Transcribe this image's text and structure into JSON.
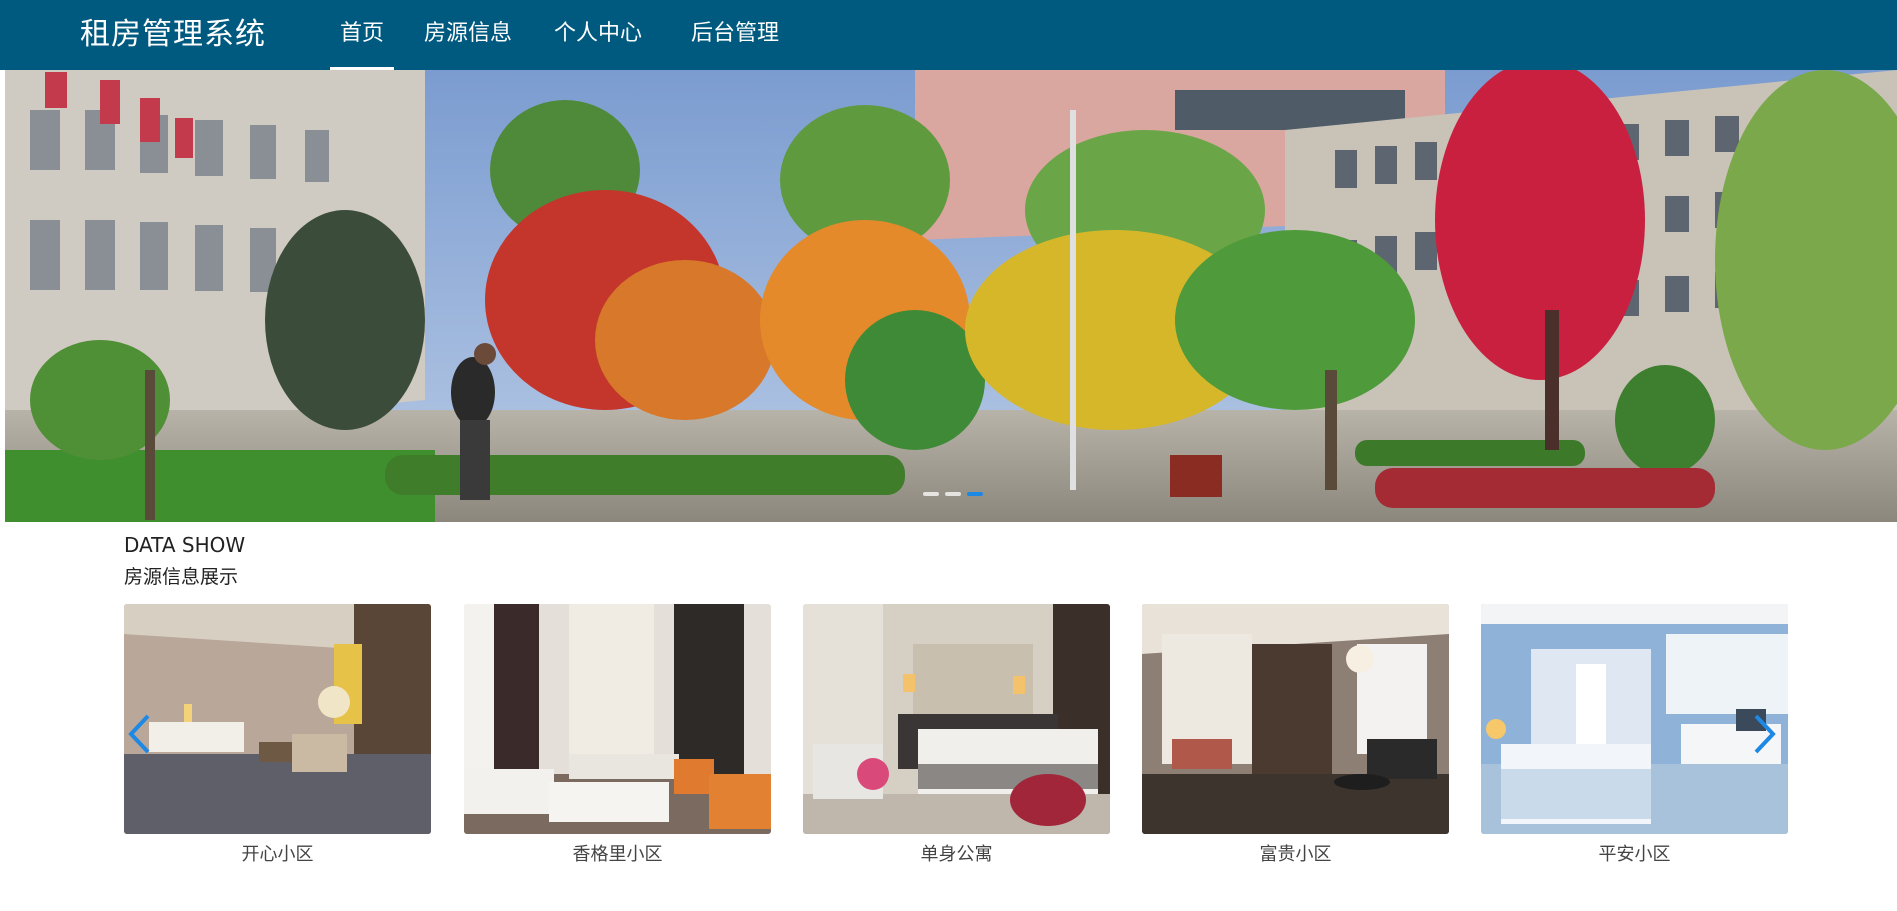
{
  "header": {
    "brand": "租房管理系统",
    "nav": [
      {
        "label": "首页",
        "active": true
      },
      {
        "label": "房源信息",
        "active": false
      },
      {
        "label": "个人中心",
        "active": false
      },
      {
        "label": "后台管理",
        "active": false
      }
    ],
    "bg_color": "#005a80"
  },
  "banner": {
    "image": "campus-autumn-photo",
    "slides": 3,
    "active_slide": 2
  },
  "section": {
    "title_en": "DATA SHOW",
    "title_cn": "房源信息展示"
  },
  "listings": [
    {
      "name": "开心小区",
      "image": "hotel-suite-photo"
    },
    {
      "name": "香格里小区",
      "image": "living-room-photo"
    },
    {
      "name": "单身公寓",
      "image": "bedroom-photo"
    },
    {
      "name": "富贵小区",
      "image": "luxury-suite-photo"
    },
    {
      "name": "平安小区",
      "image": "kids-bedroom-photo"
    }
  ],
  "carousel_controls": {
    "prev_icon": "chevron-left-icon",
    "next_icon": "chevron-right-icon",
    "color": "#1e88e5"
  }
}
